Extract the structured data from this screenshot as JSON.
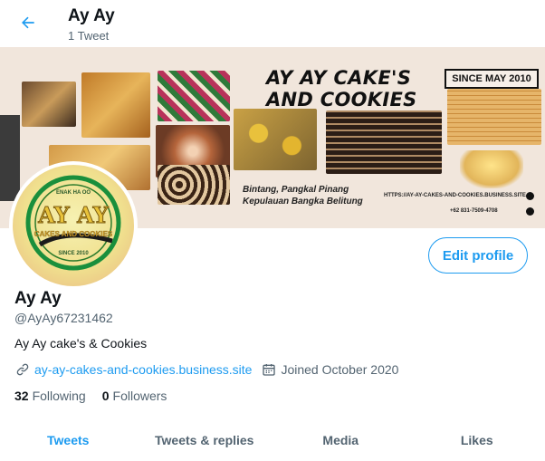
{
  "header": {
    "title": "Ay Ay",
    "tweet_count": "1 Tweet"
  },
  "banner": {
    "heading_line1": "AY AY CAKE'S",
    "heading_line2": "AND COOKIES",
    "since": "SINCE MAY 2010",
    "location_line1": "Bintang, Pangkal Pinang",
    "location_line2": "Kepulauan Bangka Belitung",
    "website": "HTTPS://AY-AY-CAKES-AND-COOKIES.BUSINESS.SITE",
    "phone": "+62 831-7509-4708"
  },
  "avatar": {
    "logo_top": "ENAK HA OO",
    "logo_main": "AY AY",
    "logo_sub": "CAKES AND COOKIES",
    "logo_since": "SINCE 2010"
  },
  "profile": {
    "edit_label": "Edit profile",
    "name": "Ay Ay",
    "handle": "@AyAy67231462",
    "bio": "Ay Ay cake's & Cookies",
    "website": "ay-ay-cakes-and-cookies.business.site",
    "joined": "Joined October 2020",
    "following_count": "32",
    "following_label": "Following",
    "followers_count": "0",
    "followers_label": "Followers"
  },
  "tabs": [
    {
      "label": "Tweets",
      "active": true
    },
    {
      "label": "Tweets & replies",
      "active": false
    },
    {
      "label": "Media",
      "active": false
    },
    {
      "label": "Likes",
      "active": false
    }
  ],
  "colors": {
    "accent": "#1d9bf0",
    "text": "#0f1419",
    "secondary": "#536471"
  },
  "icons": {
    "back": "arrow-left-icon",
    "link": "link-icon",
    "calendar": "calendar-icon"
  }
}
